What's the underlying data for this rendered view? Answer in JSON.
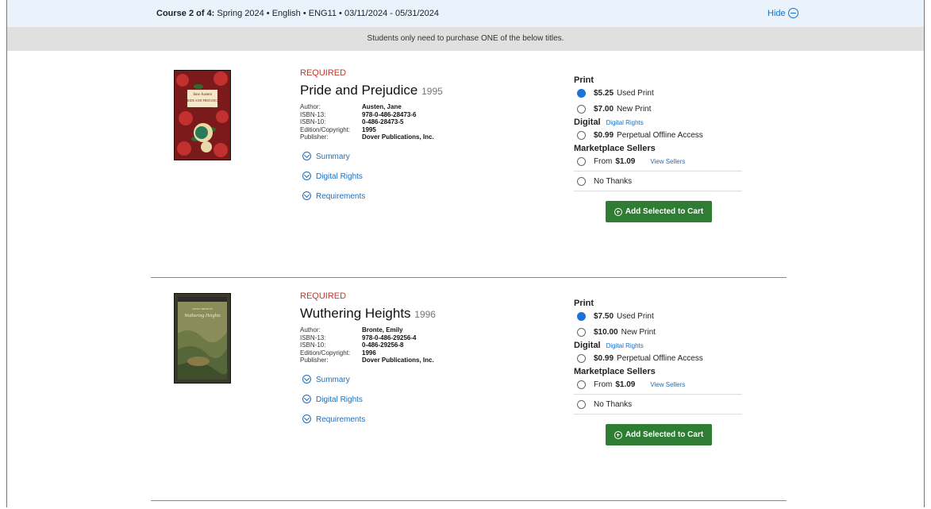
{
  "course": {
    "label": "Course 2 of 4:",
    "info": " Spring 2024 • English • ENG11 • 03/11/2024 - 05/31/2024",
    "hide": "Hide"
  },
  "notice": "Students only need to purchase ONE of the below titles.",
  "books": [
    {
      "status": "REQUIRED",
      "title": "Pride and Prejudice",
      "year": "1995",
      "author_label": "Author:",
      "author": "Austen, Jane",
      "isbn13_label": "ISBN-13:",
      "isbn13": "978-0-486-28473-6",
      "isbn10_label": "ISBN-10:",
      "isbn10": "0-486-28473-5",
      "edition_label": "Edition/Copyright:",
      "edition": "1995",
      "publisher_label": "Publisher:",
      "publisher": "Dover Publications, Inc.",
      "summary": "Summary",
      "digital_rights": "Digital Rights",
      "requirements": "Requirements",
      "print_heading": "Print",
      "used_price": "$5.25",
      "used_label": "Used Print",
      "new_price": "$7.00",
      "new_label": "New Print",
      "digital_heading": "Digital",
      "digital_rights_link": "Digital Rights",
      "digital_price": "$0.99",
      "digital_label": "Perpetual Offline Access",
      "market_heading": "Marketplace Sellers",
      "from_label": "From",
      "from_price": "$1.09",
      "view_sellers": "View Sellers",
      "no_thanks": "No Thanks",
      "add_button": "Add Selected to Cart",
      "cover_author": "Jane Austen",
      "cover_title": "PRIDE AND PREJUDICE"
    },
    {
      "status": "REQUIRED",
      "title": "Wuthering Heights",
      "year": "1996",
      "author_label": "Author:",
      "author": "Bronte, Emily",
      "isbn13_label": "ISBN-13:",
      "isbn13": "978-0-486-29256-4",
      "isbn10_label": "ISBN-10:",
      "isbn10": "0-486-29256-8",
      "edition_label": "Edition/Copyright:",
      "edition": "1996",
      "publisher_label": "Publisher:",
      "publisher": "Dover Publications, Inc.",
      "summary": "Summary",
      "digital_rights": "Digital Rights",
      "requirements": "Requirements",
      "print_heading": "Print",
      "used_price": "$7.50",
      "used_label": "Used Print",
      "new_price": "$10.00",
      "new_label": "New Print",
      "digital_heading": "Digital",
      "digital_rights_link": "Digital Rights",
      "digital_price": "$0.99",
      "digital_label": "Perpetual Offline Access",
      "market_heading": "Marketplace Sellers",
      "from_label": "From",
      "from_price": "$1.09",
      "view_sellers": "View Sellers",
      "no_thanks": "No Thanks",
      "add_button": "Add Selected to Cart",
      "cover_author": "EMILY BRONTË",
      "cover_title": "Wuthering Heights"
    }
  ],
  "colors": {
    "header_bg": "#eaf3fb",
    "notice_bg": "#e0e0e0",
    "required": "#c0392b",
    "link": "#1a6fbf",
    "button": "#2e7d32",
    "radio_selected": "#1a73d9"
  }
}
